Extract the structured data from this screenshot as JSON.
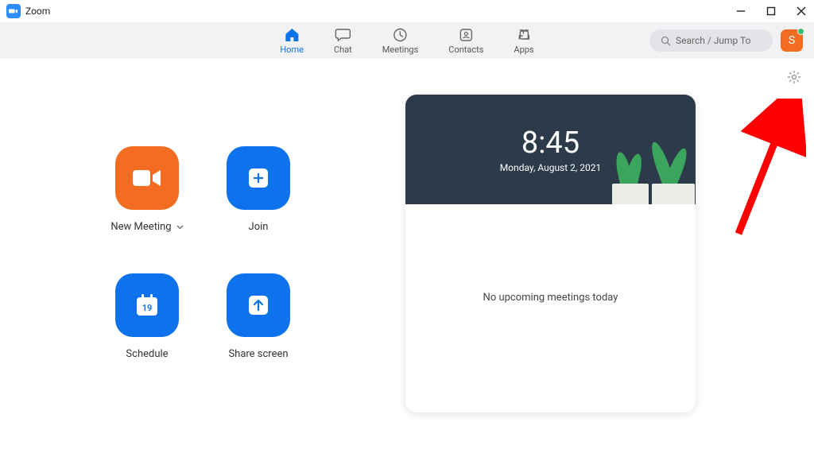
{
  "window": {
    "title": "Zoom"
  },
  "tabs": {
    "home": "Home",
    "chat": "Chat",
    "meetings": "Meetings",
    "contacts": "Contacts",
    "apps": "Apps"
  },
  "search": {
    "placeholder": "Search / Jump To"
  },
  "avatar": {
    "initial": "S"
  },
  "actions": {
    "new_meeting": "New Meeting",
    "join": "Join",
    "schedule": "Schedule",
    "schedule_day": "19",
    "share": "Share screen"
  },
  "clock": {
    "time": "8:45",
    "date": "Monday, August 2, 2021"
  },
  "empty_state": "No upcoming meetings today"
}
